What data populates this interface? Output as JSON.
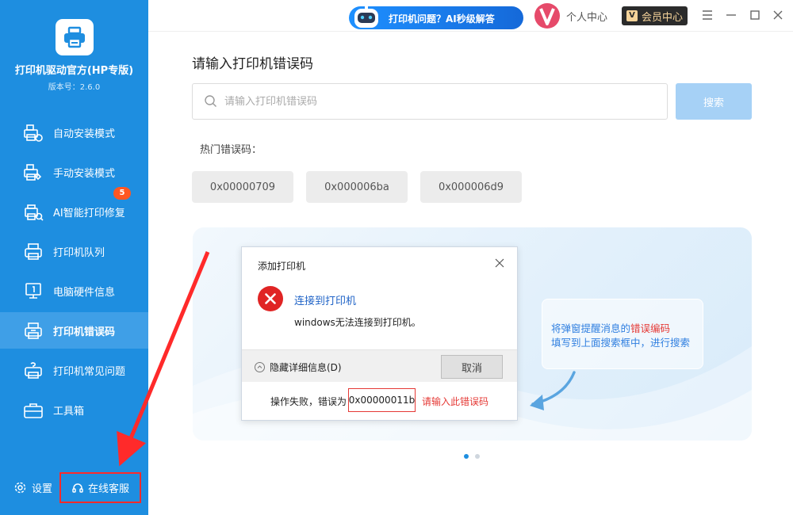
{
  "app": {
    "name": "打印机驱动官方(HP专版)",
    "version": "版本号：2.6.0"
  },
  "sidebar": {
    "items": [
      {
        "label": "自动安装模式",
        "icon": "auto-install-icon"
      },
      {
        "label": "手动安装模式",
        "icon": "manual-install-icon"
      },
      {
        "label": "AI智能打印修复",
        "icon": "ai-repair-icon",
        "badge": "5"
      },
      {
        "label": "打印机队列",
        "icon": "printer-queue-icon"
      },
      {
        "label": "电脑硬件信息",
        "icon": "hardware-info-icon"
      },
      {
        "label": "打印机错误码",
        "icon": "printer-error-icon",
        "active": true
      },
      {
        "label": "打印机常见问题",
        "icon": "printer-faq-icon"
      },
      {
        "label": "工具箱",
        "icon": "toolbox-icon"
      }
    ],
    "settings_label": "设置",
    "support_label": "在线客服"
  },
  "topbar": {
    "ai_pill_label": "打印机问题？AI秒级解答",
    "profile_label": "个人中心",
    "vip_label": "会员中心",
    "vip_badge": "V"
  },
  "main": {
    "title": "请输入打印机错误码",
    "search_placeholder": "请输入打印机错误码",
    "search_button": "搜索",
    "hot_label": "热门错误码：",
    "hot_codes": [
      "0x00000709",
      "0x000006ba",
      "0x000006d9"
    ]
  },
  "dialog": {
    "title": "添加打印机",
    "heading": "连接到打印机",
    "message": "windows无法连接到打印机。",
    "details_label": "隐藏详细信息(D)",
    "cancel_label": "取消",
    "status_prefix": "操作失败，错误为",
    "error_code": "0x00000011b",
    "hint": "请输入此错误码"
  },
  "tip": {
    "line1_prefix": "将弹窗提醒消息的",
    "line1_highlight": "错误编码",
    "line2": "填写到上面搜索框中，进行搜索"
  },
  "colors": {
    "sidebar": "#1e8ee0",
    "accent": "#2f7fe0",
    "error": "#e53935",
    "annotation": "#ff2a2a"
  }
}
